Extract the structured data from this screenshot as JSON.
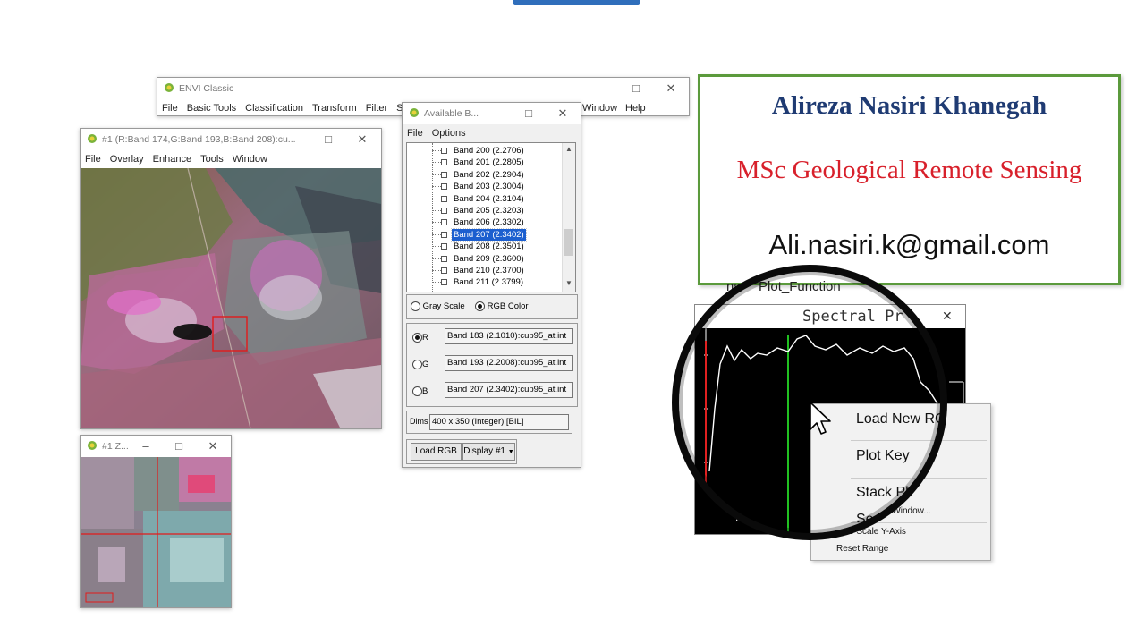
{
  "envi_classic": {
    "title": "ENVI Classic",
    "menu": [
      "File",
      "Basic Tools",
      "Classification",
      "Transform",
      "Filter",
      "Spec",
      "Window",
      "Help"
    ]
  },
  "display_window": {
    "title": "#1 (R:Band 174,G:Band 193,B:Band 208):cu...",
    "menu": [
      "File",
      "Overlay",
      "Enhance",
      "Tools",
      "Window"
    ]
  },
  "zoom_window": {
    "title": "#1 Z..."
  },
  "available_bands": {
    "title": "Available B...",
    "menu": [
      "File",
      "Options"
    ],
    "bands": [
      "Band 200 (2.2706)",
      "Band 201 (2.2805)",
      "Band 202 (2.2904)",
      "Band 203 (2.3004)",
      "Band 204 (2.3104)",
      "Band 205 (2.3203)",
      "Band 206 (2.3302)",
      "Band 207 (2.3402)",
      "Band 208 (2.3501)",
      "Band 209 (2.3600)",
      "Band 210 (2.3700)",
      "Band 211 (2.3799)"
    ],
    "selected_band": "Band 207 (2.3402)",
    "mode": {
      "gray": "Gray Scale",
      "rgb": "RGB Color",
      "selected": "RGB Color"
    },
    "channels": {
      "r_label": "R",
      "r_value": "Band 183 (2.1010):cup95_at.int",
      "g_label": "G",
      "g_value": "Band 193 (2.2008):cup95_at.int",
      "b_label": "B",
      "b_value": "Band 207 (2.3402):cup95_at.int"
    },
    "dims_label": "Dims",
    "dims_value": "400 x 350 (Integer) [BIL]",
    "load_button": "Load RGB",
    "display_select": "Display #1"
  },
  "card": {
    "name": "Alireza Nasiri Khanegah",
    "degree": "MSc Geological Remote Sensing",
    "email": "Ali.nasiri.k@gmail.com"
  },
  "spectral": {
    "menu_partial": "ns",
    "menu_plot": "Plot_Function",
    "title_partial": "Spectral Pr",
    "context_menu": [
      "Load New RG",
      "Plot Key",
      "Stack Pl",
      "Se",
      "g Window...",
      "o Scale Y-Axis",
      "Reset Range"
    ]
  },
  "colors": {
    "accent_blue": "#1c5fcf",
    "card_border": "#5b9a3c",
    "name_color": "#1f3b73",
    "degree_color": "#d8202b"
  }
}
